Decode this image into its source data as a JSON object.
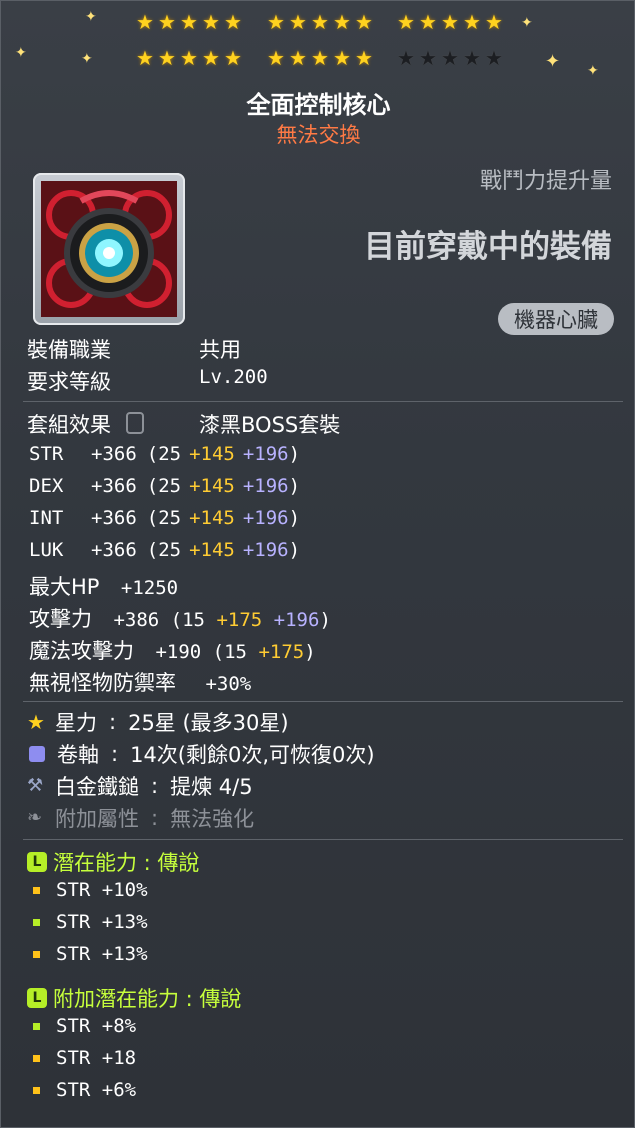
{
  "stars": {
    "row1": [
      true,
      true,
      true,
      true,
      true,
      true,
      true,
      true,
      true,
      true,
      true,
      true,
      true,
      true,
      true
    ],
    "row2": [
      true,
      true,
      true,
      true,
      true,
      true,
      true,
      true,
      true,
      true,
      false,
      false,
      false,
      false,
      false
    ],
    "glyph": "★"
  },
  "item": {
    "name": "全面控制核心",
    "trade": "無法交換",
    "combat_label": "戰鬥力提升量",
    "equipped_label": "目前穿戴中的裝備",
    "type_badge": "機器心臟"
  },
  "info": {
    "job_label": "裝備職業",
    "job_value": "共用",
    "level_label": "要求等級",
    "level_value": "Lv.200"
  },
  "set": {
    "label": "套組效果",
    "value": "漆黑BOSS套裝"
  },
  "stats": [
    {
      "name": "STR",
      "total": "+366",
      "base": "(25",
      "yellow": "+145",
      "violet": "+196",
      "close": ")"
    },
    {
      "name": "DEX",
      "total": "+366",
      "base": "(25",
      "yellow": "+145",
      "violet": "+196",
      "close": ")"
    },
    {
      "name": "INT",
      "total": "+366",
      "base": "(25",
      "yellow": "+145",
      "violet": "+196",
      "close": ")"
    },
    {
      "name": "LUK",
      "total": "+366",
      "base": "(25",
      "yellow": "+145",
      "violet": "+196",
      "close": ")"
    }
  ],
  "extra_stats": {
    "hp_label": "最大HP",
    "hp_value": "+1250",
    "atk_label": "攻擊力",
    "atk_total": "+386",
    "atk_base": "(15",
    "atk_yellow": "+175",
    "atk_violet": "+196",
    "atk_close": ")",
    "matk_label": "魔法攻擊力",
    "matk_total": "+190",
    "matk_base": "(15",
    "matk_yellow": "+175",
    "matk_close": ")",
    "ignore_label": "無視怪物防禦率",
    "ignore_value": "+30%"
  },
  "misc": {
    "star_label": "星力",
    "star_value": "25星 (最多30星)",
    "scroll_label": "卷軸",
    "scroll_value": "14次(剩餘0次,可恢復0次)",
    "hammer_label": "白金鐵鎚",
    "hammer_value": "提煉 4/5",
    "bonus_label": "附加屬性",
    "bonus_value": "無法強化",
    "sep": ":"
  },
  "potential": {
    "badge": "L",
    "label": "潛在能力 : 傳說",
    "lines": [
      "STR +10%",
      "STR +13%",
      "STR +13%"
    ]
  },
  "additional": {
    "badge": "L",
    "label": "附加潛在能力 : 傳說",
    "lines": [
      "STR +8%",
      "STR +18",
      "STR +6%"
    ]
  },
  "colors": {
    "trade": "#ff7a45",
    "yellow": "#ffcc33",
    "violet": "#b8b2ff",
    "potential": "#c6ff3c",
    "star": "#ffd21f"
  }
}
